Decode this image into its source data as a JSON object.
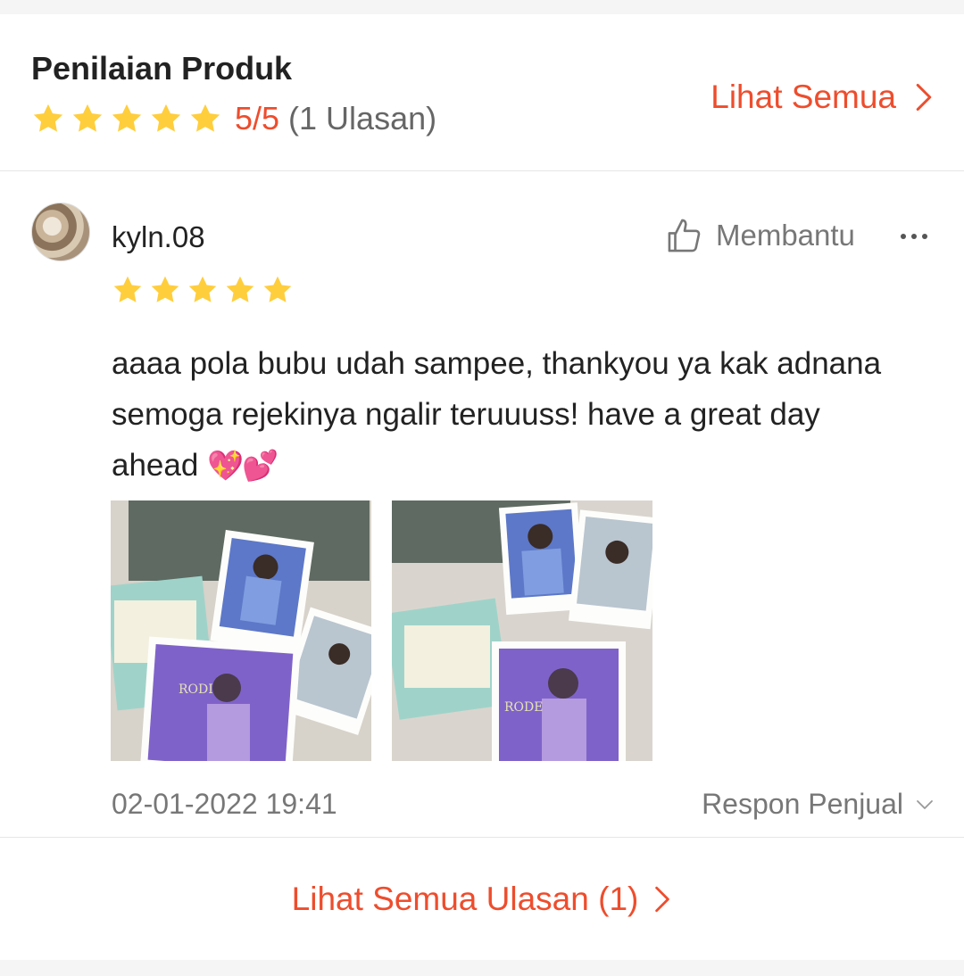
{
  "header": {
    "title": "Penilaian Produk",
    "rating": "5/5",
    "count": "(1 Ulasan)",
    "see_all": "Lihat Semua",
    "star_count": 5
  },
  "review": {
    "username": "kyln.08",
    "stars": 5,
    "helpful_label": "Membantu",
    "comment": "aaaa pola bubu udah sampee, thankyou ya kak adnana semoga rejekinya ngalir teruuuss! have a great day ahead",
    "comment_emoji": "💖💕",
    "photos": [
      "review-photo-1",
      "review-photo-2"
    ],
    "date": "02-01-2022 19:41",
    "seller_response": "Respon Penjual"
  },
  "footer": {
    "see_all_reviews": "Lihat Semua Ulasan (1)"
  },
  "colors": {
    "accent": "#ee4d2d",
    "star": "#ffce3d",
    "muted": "#777777",
    "divider": "#e6e6e6"
  },
  "icons": [
    "star-icon",
    "chevron-right-icon",
    "thumbs-up-icon",
    "more-dots-icon",
    "chevron-down-icon"
  ]
}
